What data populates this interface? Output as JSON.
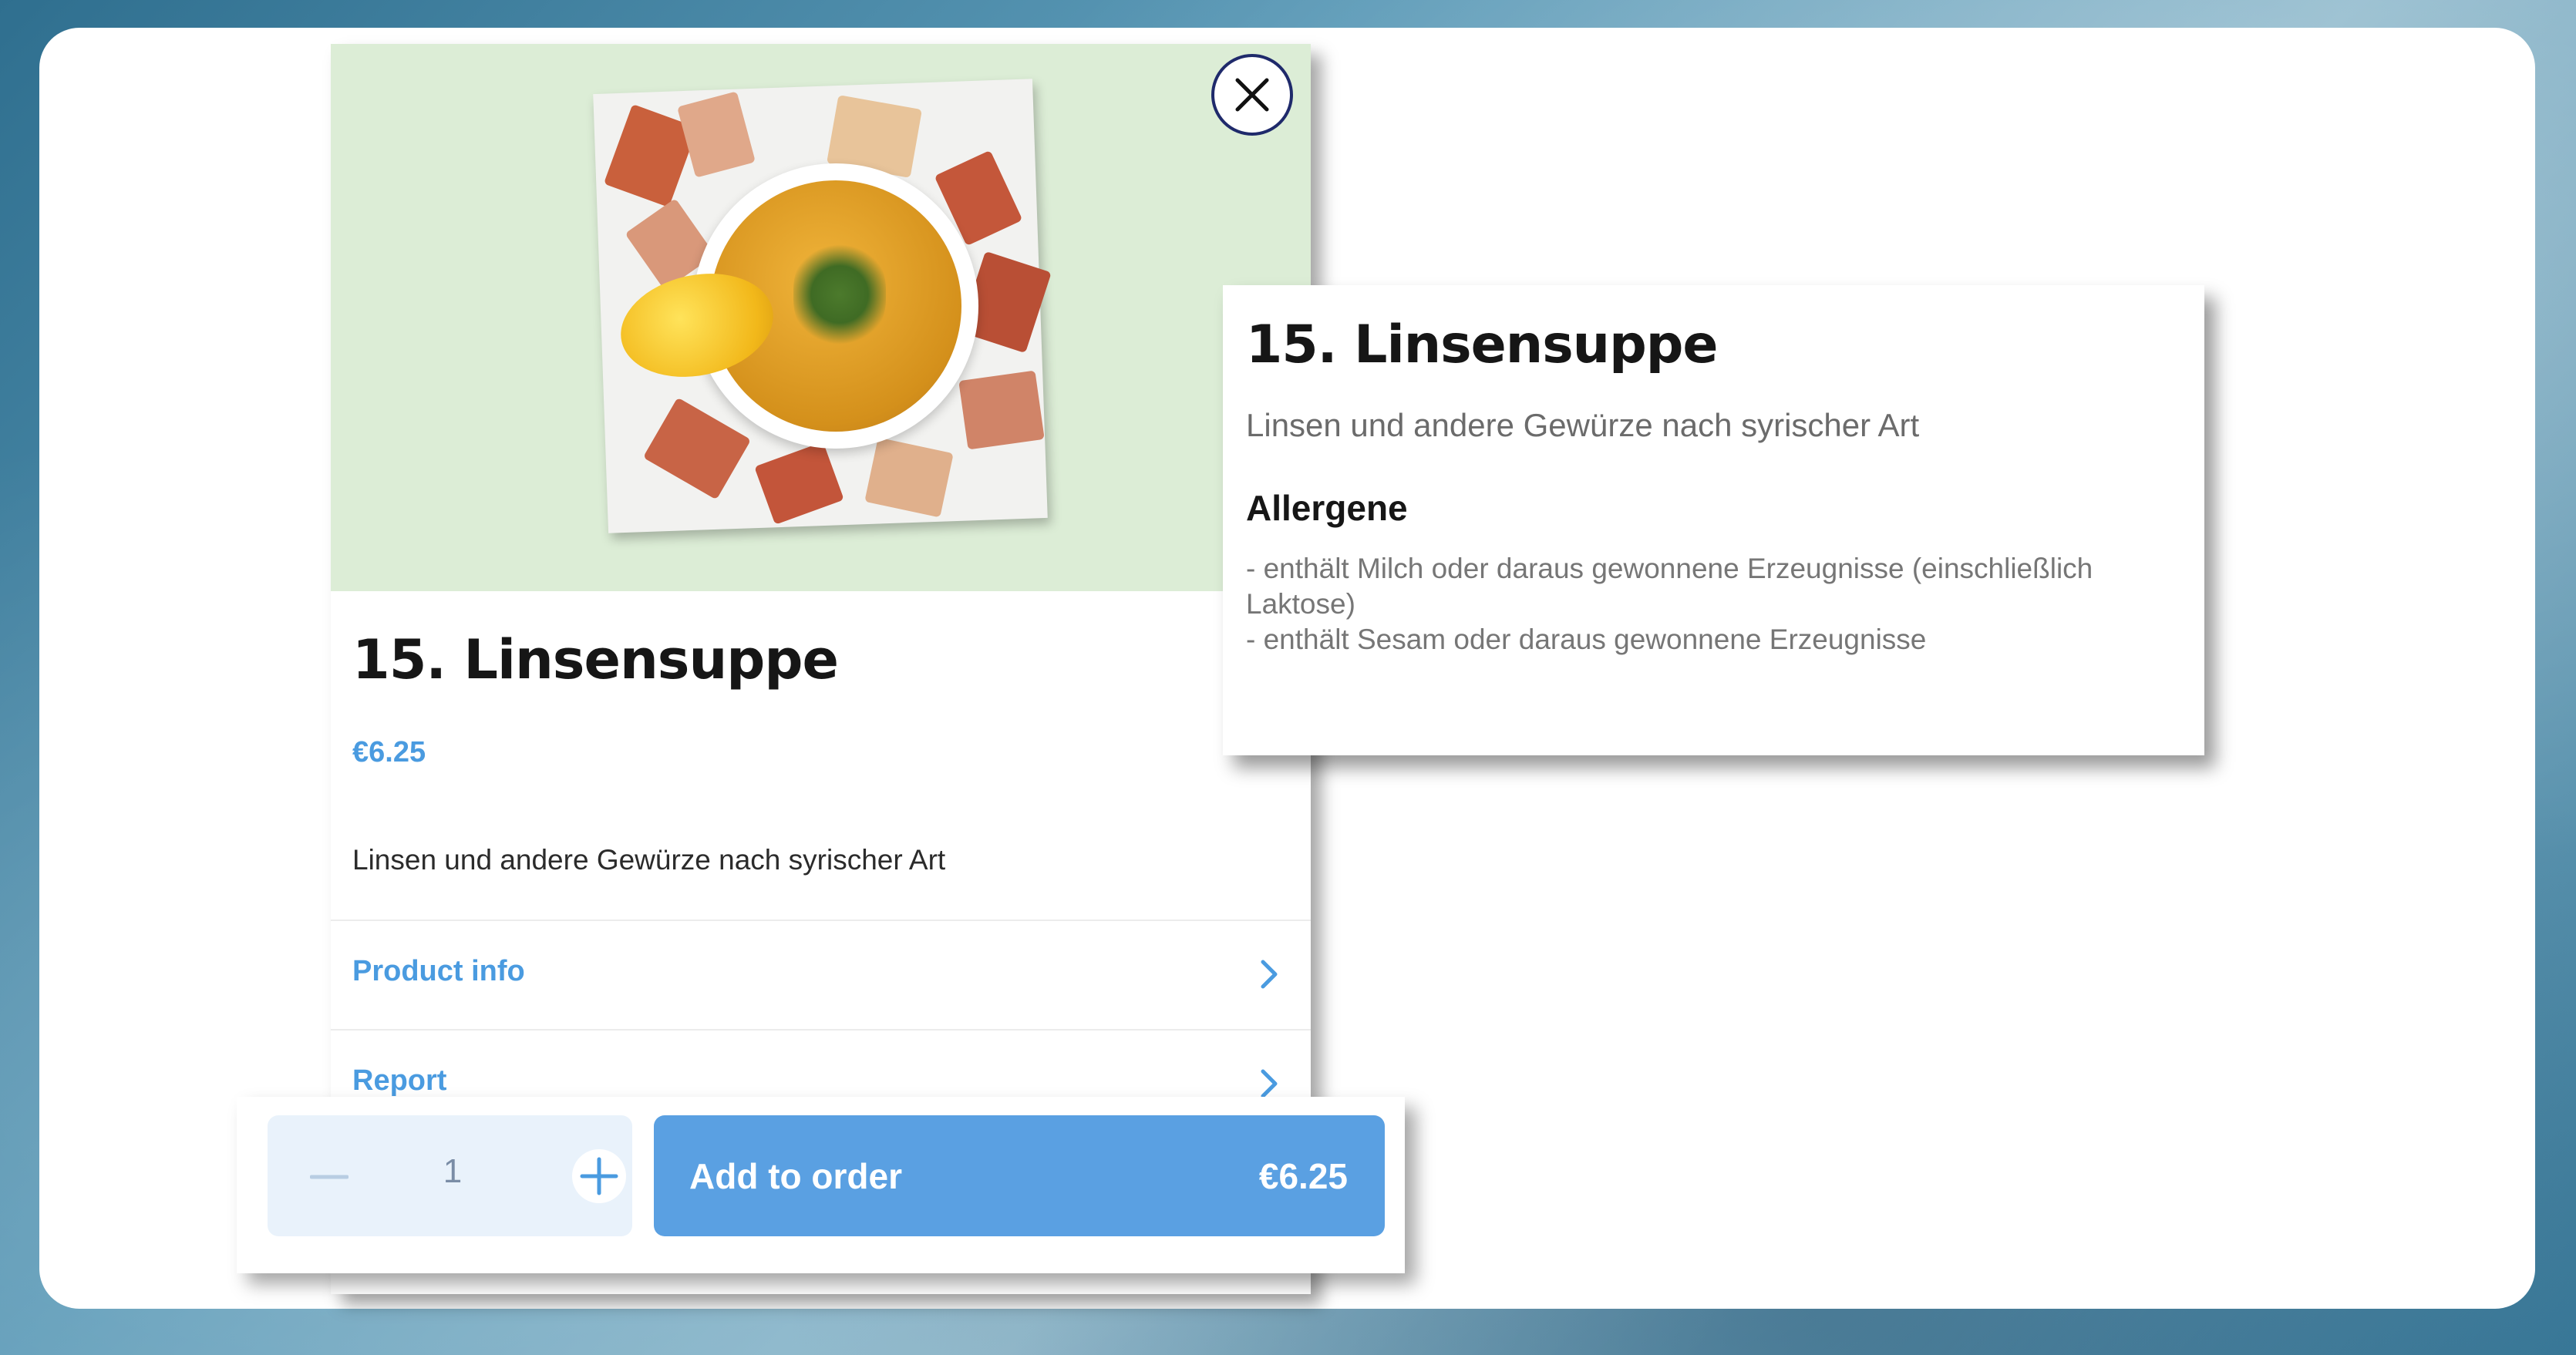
{
  "product": {
    "title": "15. Linsensuppe",
    "price": "€6.25",
    "description": "Linsen und andere Gewürze nach syrischer Art",
    "links": [
      {
        "label": "Product info"
      },
      {
        "label": "Report"
      }
    ]
  },
  "order": {
    "quantity": "1",
    "add_label": "Add to order",
    "total": "€6.25"
  },
  "info_popup": {
    "title": "15. Linsensuppe",
    "description": "Linsen und andere Gewürze nach syrischer Art",
    "allergens_heading": "Allergene",
    "allergens": [
      "- enthält Milch oder daraus gewonnene Erzeugnisse (einschließlich Laktose)",
      "- enthält Sesam oder daraus gewonnene Erzeugnisse"
    ]
  },
  "colors": {
    "accent": "#4a9be0",
    "button": "#5aa0e2",
    "hero_bg": "#dcedd6",
    "close_ring": "#1f2a6b"
  },
  "icons": [
    "close-icon",
    "chevron-right-icon",
    "minus-icon",
    "plus-icon"
  ]
}
